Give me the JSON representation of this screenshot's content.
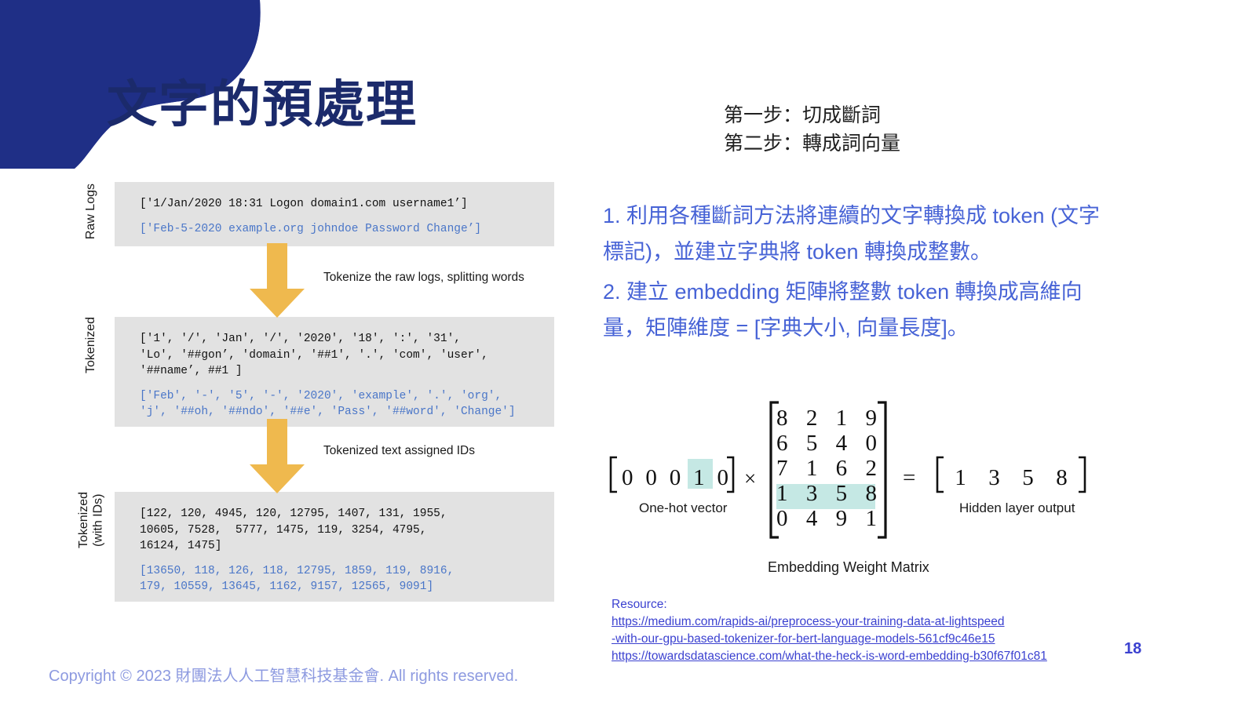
{
  "slide": {
    "title": "文字的預處理",
    "page_number": "18",
    "copyright": "Copyright © 2023 財團法人人工智慧科技基金會. All rights reserved.",
    "accent_navy": "#1b2a6b",
    "accent_blue": "#4763d6",
    "accent_orange": "#efb94e",
    "code_bg": "#e2e2e2",
    "highlight_teal": "#c5e8e4"
  },
  "steps": [
    "第一步：切成斷詞",
    "第二步：轉成詞向量"
  ],
  "body": {
    "paragraph1": "1. 利用各種斷詞方法將連續的文字轉換成 token (文字標記)，並建立字典將 token 轉換成整數。",
    "paragraph2": "2. 建立 embedding 矩陣將整數 token 轉換成高維向量，矩陣維度 = [字典大小, 向量長度]。"
  },
  "pipeline": {
    "rows": [
      {
        "label": "Raw Logs",
        "lines_black": [
          "['1/Jan/2020 18:31 Logon domain1.com username1’]"
        ],
        "lines_blue": [
          "['Feb-5-2020 example.org johndoe Password Change’]"
        ]
      },
      {
        "label": "Tokenized",
        "lines_black": [
          "['1', '/', 'Jan', '/', '2020', '18', ':', '31',",
          "'Lo', '##gon’, 'domain', '##1', '.', 'com', 'user',",
          "'##name’, ##1 ]"
        ],
        "lines_blue": [
          "['Feb', '-', '5', '-', '2020', 'example', '.', 'org',",
          "'j', '##oh, '##ndo', '##e', 'Pass', '##word', 'Change']"
        ]
      },
      {
        "label": "Tokenized\n(with IDs)",
        "lines_black": [
          "[122, 120, 4945, 120, 12795, 1407, 131, 1955,",
          "10605, 7528,  5777, 1475, 119, 3254, 4795,",
          "16124, 1475]"
        ],
        "lines_blue": [
          "[13650, 118, 126, 118, 12795, 1859, 119, 8916,",
          "179, 10559, 13645, 1162, 9157, 12565, 9091]"
        ]
      }
    ],
    "arrow_captions": [
      "Tokenize the raw logs, splitting words",
      "Tokenized text assigned IDs"
    ]
  },
  "matrix_figure": {
    "onehot_vector": [
      "0",
      "0",
      "0",
      "1",
      "0"
    ],
    "onehot_highlight_index": 3,
    "operator_multiply": "×",
    "operator_equals": "=",
    "weight_matrix": [
      [
        "8",
        "2",
        "1",
        "9"
      ],
      [
        "6",
        "5",
        "4",
        "0"
      ],
      [
        "7",
        "1",
        "6",
        "2"
      ],
      [
        "1",
        "3",
        "5",
        "8"
      ],
      [
        "0",
        "4",
        "9",
        "1"
      ]
    ],
    "weight_highlight_row": 3,
    "output_vector": [
      "1",
      "3",
      "5",
      "8"
    ],
    "caption_onehot": "One-hot vector",
    "caption_hidden": "Hidden layer output",
    "caption_matrix": "Embedding Weight Matrix"
  },
  "resources": {
    "heading": "Resource:",
    "links": [
      "https://medium.com/rapids-ai/preprocess-your-training-data-at-lightspeed",
      "-with-our-gpu-based-tokenizer-for-bert-language-models-561cf9c46e15",
      "https://towardsdatascience.com/what-the-heck-is-word-embedding-b30f67f01c81"
    ]
  }
}
